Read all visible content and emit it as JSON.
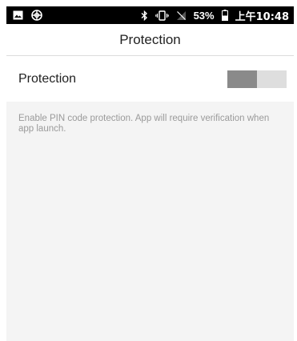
{
  "status_bar": {
    "left_icons": [
      "image-icon",
      "app-notification-icon"
    ],
    "right_icons": [
      "bluetooth-icon",
      "vibrate-icon",
      "no-signal-icon",
      "battery-icon"
    ],
    "battery_percent": "53%",
    "time": "上午10:48"
  },
  "header": {
    "title": "Protection"
  },
  "settings": {
    "protection": {
      "label": "Protection",
      "enabled": false
    }
  },
  "description": {
    "text": "Enable PIN code protection. App will require verification when app launch."
  },
  "colors": {
    "status_bar_bg": "#000000",
    "toggle_thumb": "#8a8a8a",
    "toggle_track": "#dedede",
    "panel_bg": "#f4f4f4",
    "description_text": "#9a9a9a"
  }
}
